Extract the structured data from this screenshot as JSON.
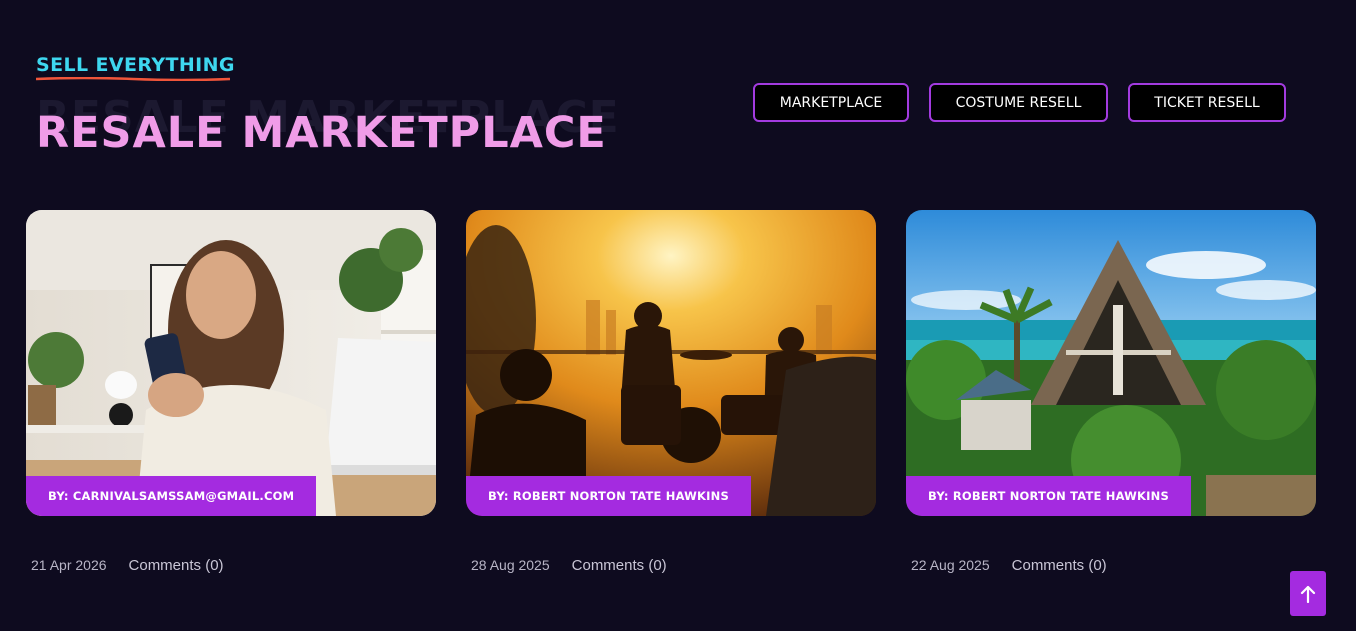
{
  "header": {
    "eyebrow": "SELL EVERYTHING",
    "title": "RESALE MARKETPLACE",
    "title_shadow": "RESALE MARKETPLACE"
  },
  "filters": [
    {
      "label": "MARKETPLACE"
    },
    {
      "label": "COSTUME RESELL"
    },
    {
      "label": "TICKET RESELL"
    }
  ],
  "posts": [
    {
      "author": "BY: CARNIVALSAMSSAM@GMAIL.COM",
      "date": "21 Apr 2026",
      "comments": "Comments (0)",
      "image": "woman-with-phone-photo"
    },
    {
      "author": "BY: ROBERT NORTON TATE HAWKINS",
      "date": "28 Aug 2025",
      "comments": "Comments (0)",
      "image": "sunset-band-photo"
    },
    {
      "author": "BY: ROBERT NORTON TATE HAWKINS",
      "date": "22 Aug 2025",
      "comments": "Comments (0)",
      "image": "beach-resort-photo"
    }
  ],
  "colors": {
    "background": "#0e0b1f",
    "accent": "#a42be0",
    "eyebrow": "#3ed7ef",
    "title": "#f09ce8"
  },
  "scroll_top_icon": "arrow-up-icon"
}
